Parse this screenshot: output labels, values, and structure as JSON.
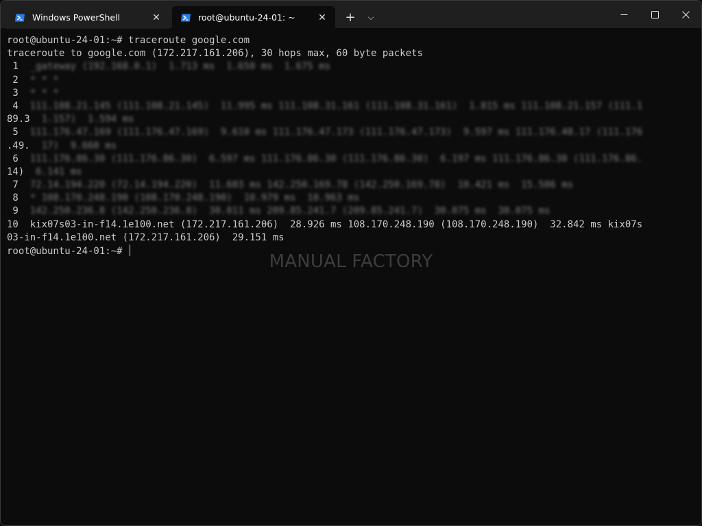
{
  "tabs": [
    {
      "label": "Windows PowerShell",
      "icon": "powershell-icon",
      "close": "✕"
    },
    {
      "label": "root@ubuntu-24-01: ~",
      "icon": "powershell-icon",
      "close": "✕"
    }
  ],
  "titlebar": {
    "new_tab": "+",
    "tab_menu": "⌵",
    "minimize": "—",
    "maximize": "☐",
    "close": "✕"
  },
  "terminal": {
    "lines": [
      "root@ubuntu-24-01:~# traceroute google.com",
      "traceroute to google.com (172.217.161.206), 30 hops max, 60 byte packets",
      " 1  _gateway (192.168.0.1)  1.713 ms  1.650 ms  1.675 ms",
      " 2  * * *",
      " 3  * * *",
      " 4  111.108.21.145 (111.108.21.145)  11.995 ms 111.108.31.161 (111.108.31.161)  1.815 ms 111.108.21.157 (111.1",
      "89.3  1.157)  1.594 ms",
      " 5  111.176.47.169 (111.176.47.169)  9.610 ms 111.176.47.173 (111.176.47.173)  9.597 ms 111.176.48.17 (111.176",
      ".49.  17)  9.660 ms",
      " 6  111.176.86.30 (111.176.86.30)  6.597 ms 111.176.86.30 (111.176.86.30)  6.197 ms 111.176.86.30 (111.176.86.",
      "14)  6.141 ms",
      " 7  72.14.194.220 (72.14.194.220)  11.603 ms 142.250.169.78 (142.250.169.78)  10.421 ms  15.506 ms",
      " 8  * 108.170.248.190 (108.170.248.190)  10.979 ms  10.963 ms",
      " 9  142.250.236.8 (142.250.236.8)  30.011 ms 209.85.241.7 (209.85.241.7)  30.075 ms  30.075 ms",
      "10  kix07s03-in-f14.1e100.net (172.217.161.206)  28.926 ms 108.170.248.190 (108.170.248.190)  32.842 ms kix07s",
      "03-in-f14.1e100.net (172.217.161.206)  29.151 ms"
    ],
    "prompt": "root@ubuntu-24-01:~# "
  },
  "watermark": "MANUAL FACTORY",
  "colors": {
    "background": "#0c0c0c",
    "titlebar": "#1f1f1f",
    "text": "#cccccc",
    "accent": "#2a7de1"
  }
}
